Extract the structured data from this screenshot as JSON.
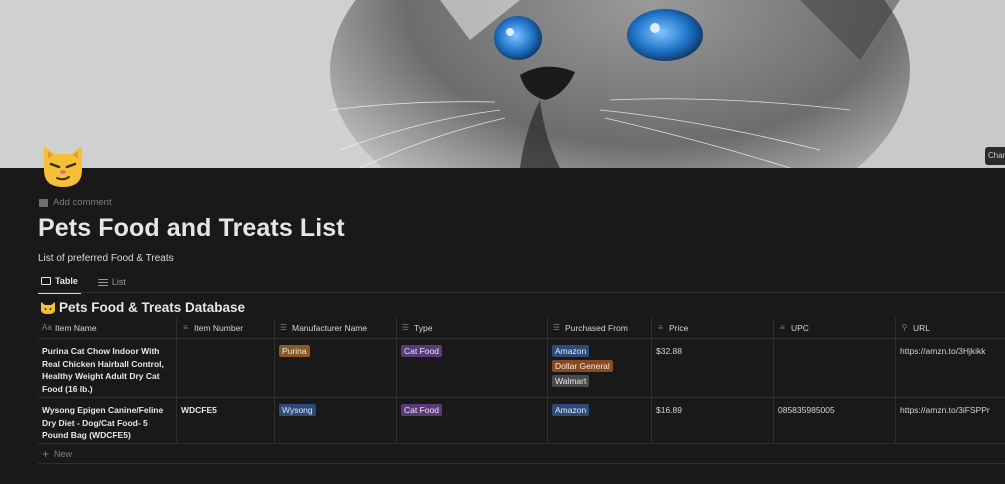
{
  "cover": {
    "change_label": "Change cover"
  },
  "page": {
    "icon": "cat-face-smirk-icon",
    "add_comment": "Add comment",
    "title": "Pets Food and Treats List",
    "description": "List of preferred Food & Treats"
  },
  "views": [
    {
      "label": "Table",
      "icon": "table-icon",
      "active": true
    },
    {
      "label": "List",
      "icon": "list-icon",
      "active": false
    }
  ],
  "database": {
    "icon": "cat-icon",
    "title": "Pets Food & Treats Database",
    "columns": [
      {
        "label": "Item Name",
        "icon": "title-Aa-icon"
      },
      {
        "label": "Item Number",
        "icon": "text-lines-icon"
      },
      {
        "label": "Manufacturer Name",
        "icon": "list-icon"
      },
      {
        "label": "Type",
        "icon": "list-icon"
      },
      {
        "label": "Purchased From",
        "icon": "list-icon"
      },
      {
        "label": "Price",
        "icon": "text-lines-icon"
      },
      {
        "label": "UPC",
        "icon": "text-lines-icon"
      },
      {
        "label": "URL",
        "icon": "link-icon"
      }
    ],
    "rows": [
      {
        "item_name": "Purina Cat Chow Indoor With Real Chicken Hairball Control, Healthy Weight Adult Dry Cat Food (16 lb.)",
        "item_number": "",
        "manufacturer": "Purina",
        "type": "Cat Food",
        "purchased_from": [
          "Amazon",
          "Dollar General",
          "Walmart"
        ],
        "price": "$32.88",
        "upc": "",
        "url": "https://amzn.to/3Hjkikk"
      },
      {
        "item_name": "Wysong Epigen Canine/Feline Dry Diet - Dog/Cat Food- 5 Pound Bag (WDCFE5)",
        "item_number": "WDCFE5",
        "manufacturer": "Wysong",
        "type": "Cat Food",
        "purchased_from": [
          "Amazon"
        ],
        "price": "$16.89",
        "upc": "085835985005",
        "url": "https://amzn.to/3iFSPPr"
      }
    ],
    "new_label": "New"
  },
  "colors": {
    "purina": "#8a5a23",
    "wysong": "#2a4b7c",
    "cat_food": "#5a3a7a",
    "amazon": "#2a4b7c",
    "dollar_general": "#8a4a1d",
    "walmart": "#4a4a4a"
  }
}
